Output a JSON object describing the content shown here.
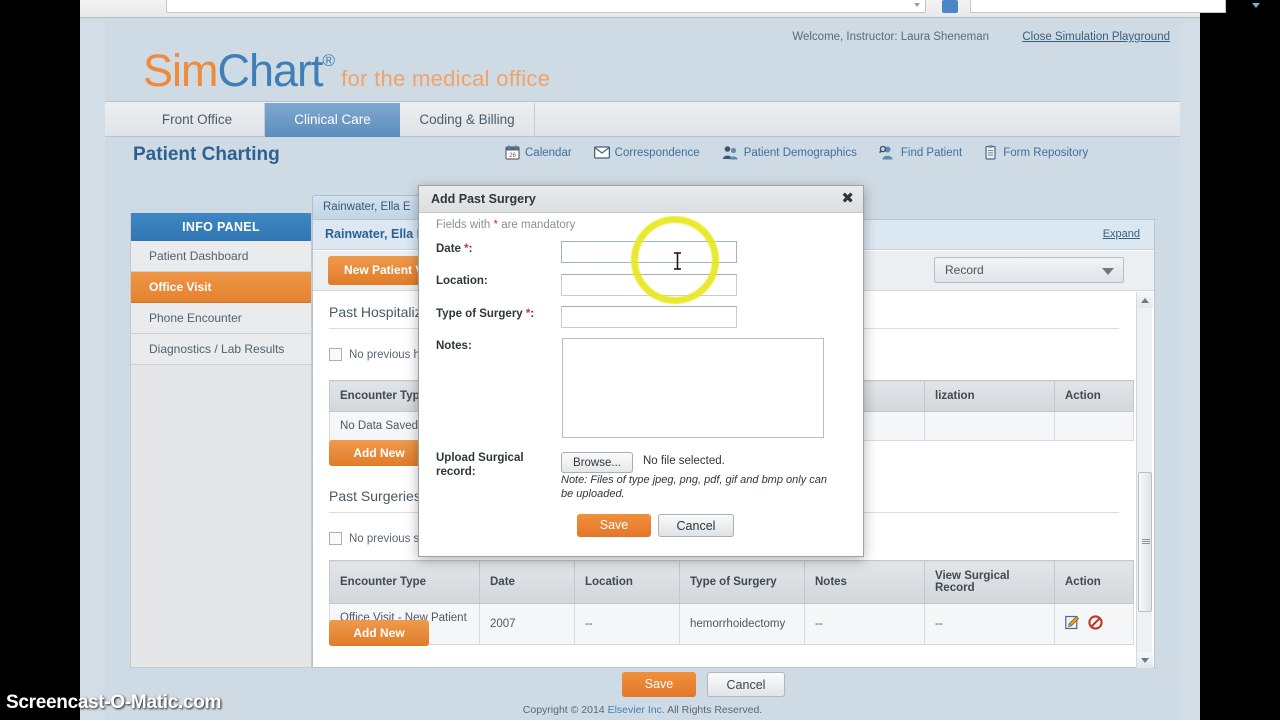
{
  "browser": {
    "chrome_visible": true
  },
  "header": {
    "welcome": "Welcome, Instructor: Laura Sheneman",
    "close_sim": "Close Simulation Playground",
    "logo_sim": "Sim",
    "logo_chart": "Chart",
    "logo_reg": "®",
    "logo_tagline": "for the medical office"
  },
  "tabs": [
    {
      "label": "Front Office",
      "active": false
    },
    {
      "label": "Clinical Care",
      "active": true
    },
    {
      "label": "Coding & Billing",
      "active": false
    }
  ],
  "page": {
    "title": "Patient Charting"
  },
  "nav_icons": [
    {
      "label": "Calendar",
      "icon": "calendar-icon"
    },
    {
      "label": "Correspondence",
      "icon": "envelope-icon"
    },
    {
      "label": "Patient Demographics",
      "icon": "people-icon"
    },
    {
      "label": "Find Patient",
      "icon": "person-search-icon"
    },
    {
      "label": "Form Repository",
      "icon": "clipboard-icon"
    }
  ],
  "sidebar": {
    "heading": "INFO PANEL",
    "items": [
      {
        "label": "Patient Dashboard",
        "active": false
      },
      {
        "label": "Office Visit",
        "active": true
      },
      {
        "label": "Phone Encounter",
        "active": false
      },
      {
        "label": "Diagnostics / Lab Results",
        "active": false
      }
    ]
  },
  "patient": {
    "tab_label": "Rainwater, Ella E",
    "tab_close": "×",
    "name_line": "Rainwater, Ella E 0",
    "expand_link": "Expand",
    "visit_button": "New Patient Vi",
    "record_select": "Record"
  },
  "sections": {
    "hospitalizations": {
      "title": "Past Hospitalizati",
      "checkbox_label": "No previous ho",
      "columns": [
        "Encounter Type",
        "",
        "",
        "",
        "",
        "lization",
        "Action"
      ],
      "empty_text": "No Data Saved",
      "add_button": "Add New"
    },
    "surgeries": {
      "title": "Past Surgeries",
      "checkbox_label": "No previous su",
      "columns": [
        "Encounter Type",
        "Date",
        "Location",
        "Type of Surgery",
        "Notes",
        "View Surgical Record",
        "Action"
      ],
      "rows": [
        {
          "encounter_type": "Office Visit - New Patient Visit 11/10/2014",
          "date": "2007",
          "location": "--",
          "type_of_surgery": "hemorrhoidectomy",
          "notes": "--",
          "view_record": "--",
          "action_edit_icon": "edit-pencil-icon",
          "action_delete_icon": "prohibited-icon"
        }
      ],
      "add_button": "Add New"
    }
  },
  "bottom": {
    "save": "Save",
    "cancel": "Cancel"
  },
  "footer": {
    "copyright_pre": "Copyright © 2014 ",
    "company": "Elsevier Inc.",
    "copyright_post": " All Rights Reserved."
  },
  "modal": {
    "title": "Add Past Surgery",
    "close_glyph": "✖",
    "mandatory_pre": "Fields with ",
    "mandatory_star": "*",
    "mandatory_post": " are mandatory",
    "fields": [
      {
        "label": "Date ",
        "star": "*",
        "suffix": ":",
        "value": "",
        "focused": true
      },
      {
        "label": "Location",
        "star": "",
        "suffix": ":",
        "value": "",
        "focused": false
      },
      {
        "label": "Type of Surgery ",
        "star": "*",
        "suffix": ":",
        "value": "",
        "focused": false
      },
      {
        "label": "Notes",
        "star": "",
        "suffix": ":",
        "value": "",
        "focused": false
      }
    ],
    "upload_label_l1": "Upload Surgical",
    "upload_label_l2": "record:",
    "browse_button": "Browse...",
    "no_file_text": "No file selected.",
    "upload_note": "Note: Files of type jpeg, png, pdf, gif and bmp only can be uploaded.",
    "save": "Save",
    "cancel": "Cancel"
  },
  "watermark": {
    "text": "Screencast-O-Matic.com"
  },
  "colors": {
    "brand_orange": "#ef8a3c",
    "brand_blue": "#3f7fb5",
    "accent_active": "#2f76b2",
    "highlight_ring": "#e8e81e",
    "mandatory_star": "#c0392b"
  }
}
